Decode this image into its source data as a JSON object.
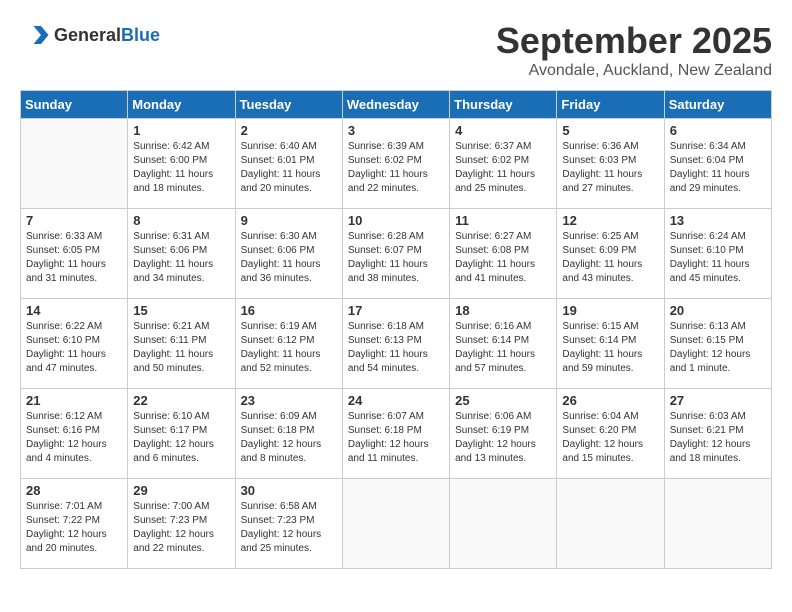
{
  "header": {
    "logo_general": "General",
    "logo_blue": "Blue",
    "month": "September 2025",
    "location": "Avondale, Auckland, New Zealand"
  },
  "weekdays": [
    "Sunday",
    "Monday",
    "Tuesday",
    "Wednesday",
    "Thursday",
    "Friday",
    "Saturday"
  ],
  "weeks": [
    [
      {
        "day": "",
        "sunrise": "",
        "sunset": "",
        "daylight": ""
      },
      {
        "day": "1",
        "sunrise": "Sunrise: 6:42 AM",
        "sunset": "Sunset: 6:00 PM",
        "daylight": "Daylight: 11 hours and 18 minutes."
      },
      {
        "day": "2",
        "sunrise": "Sunrise: 6:40 AM",
        "sunset": "Sunset: 6:01 PM",
        "daylight": "Daylight: 11 hours and 20 minutes."
      },
      {
        "day": "3",
        "sunrise": "Sunrise: 6:39 AM",
        "sunset": "Sunset: 6:02 PM",
        "daylight": "Daylight: 11 hours and 22 minutes."
      },
      {
        "day": "4",
        "sunrise": "Sunrise: 6:37 AM",
        "sunset": "Sunset: 6:02 PM",
        "daylight": "Daylight: 11 hours and 25 minutes."
      },
      {
        "day": "5",
        "sunrise": "Sunrise: 6:36 AM",
        "sunset": "Sunset: 6:03 PM",
        "daylight": "Daylight: 11 hours and 27 minutes."
      },
      {
        "day": "6",
        "sunrise": "Sunrise: 6:34 AM",
        "sunset": "Sunset: 6:04 PM",
        "daylight": "Daylight: 11 hours and 29 minutes."
      }
    ],
    [
      {
        "day": "7",
        "sunrise": "Sunrise: 6:33 AM",
        "sunset": "Sunset: 6:05 PM",
        "daylight": "Daylight: 11 hours and 31 minutes."
      },
      {
        "day": "8",
        "sunrise": "Sunrise: 6:31 AM",
        "sunset": "Sunset: 6:06 PM",
        "daylight": "Daylight: 11 hours and 34 minutes."
      },
      {
        "day": "9",
        "sunrise": "Sunrise: 6:30 AM",
        "sunset": "Sunset: 6:06 PM",
        "daylight": "Daylight: 11 hours and 36 minutes."
      },
      {
        "day": "10",
        "sunrise": "Sunrise: 6:28 AM",
        "sunset": "Sunset: 6:07 PM",
        "daylight": "Daylight: 11 hours and 38 minutes."
      },
      {
        "day": "11",
        "sunrise": "Sunrise: 6:27 AM",
        "sunset": "Sunset: 6:08 PM",
        "daylight": "Daylight: 11 hours and 41 minutes."
      },
      {
        "day": "12",
        "sunrise": "Sunrise: 6:25 AM",
        "sunset": "Sunset: 6:09 PM",
        "daylight": "Daylight: 11 hours and 43 minutes."
      },
      {
        "day": "13",
        "sunrise": "Sunrise: 6:24 AM",
        "sunset": "Sunset: 6:10 PM",
        "daylight": "Daylight: 11 hours and 45 minutes."
      }
    ],
    [
      {
        "day": "14",
        "sunrise": "Sunrise: 6:22 AM",
        "sunset": "Sunset: 6:10 PM",
        "daylight": "Daylight: 11 hours and 47 minutes."
      },
      {
        "day": "15",
        "sunrise": "Sunrise: 6:21 AM",
        "sunset": "Sunset: 6:11 PM",
        "daylight": "Daylight: 11 hours and 50 minutes."
      },
      {
        "day": "16",
        "sunrise": "Sunrise: 6:19 AM",
        "sunset": "Sunset: 6:12 PM",
        "daylight": "Daylight: 11 hours and 52 minutes."
      },
      {
        "day": "17",
        "sunrise": "Sunrise: 6:18 AM",
        "sunset": "Sunset: 6:13 PM",
        "daylight": "Daylight: 11 hours and 54 minutes."
      },
      {
        "day": "18",
        "sunrise": "Sunrise: 6:16 AM",
        "sunset": "Sunset: 6:14 PM",
        "daylight": "Daylight: 11 hours and 57 minutes."
      },
      {
        "day": "19",
        "sunrise": "Sunrise: 6:15 AM",
        "sunset": "Sunset: 6:14 PM",
        "daylight": "Daylight: 11 hours and 59 minutes."
      },
      {
        "day": "20",
        "sunrise": "Sunrise: 6:13 AM",
        "sunset": "Sunset: 6:15 PM",
        "daylight": "Daylight: 12 hours and 1 minute."
      }
    ],
    [
      {
        "day": "21",
        "sunrise": "Sunrise: 6:12 AM",
        "sunset": "Sunset: 6:16 PM",
        "daylight": "Daylight: 12 hours and 4 minutes."
      },
      {
        "day": "22",
        "sunrise": "Sunrise: 6:10 AM",
        "sunset": "Sunset: 6:17 PM",
        "daylight": "Daylight: 12 hours and 6 minutes."
      },
      {
        "day": "23",
        "sunrise": "Sunrise: 6:09 AM",
        "sunset": "Sunset: 6:18 PM",
        "daylight": "Daylight: 12 hours and 8 minutes."
      },
      {
        "day": "24",
        "sunrise": "Sunrise: 6:07 AM",
        "sunset": "Sunset: 6:18 PM",
        "daylight": "Daylight: 12 hours and 11 minutes."
      },
      {
        "day": "25",
        "sunrise": "Sunrise: 6:06 AM",
        "sunset": "Sunset: 6:19 PM",
        "daylight": "Daylight: 12 hours and 13 minutes."
      },
      {
        "day": "26",
        "sunrise": "Sunrise: 6:04 AM",
        "sunset": "Sunset: 6:20 PM",
        "daylight": "Daylight: 12 hours and 15 minutes."
      },
      {
        "day": "27",
        "sunrise": "Sunrise: 6:03 AM",
        "sunset": "Sunset: 6:21 PM",
        "daylight": "Daylight: 12 hours and 18 minutes."
      }
    ],
    [
      {
        "day": "28",
        "sunrise": "Sunrise: 7:01 AM",
        "sunset": "Sunset: 7:22 PM",
        "daylight": "Daylight: 12 hours and 20 minutes."
      },
      {
        "day": "29",
        "sunrise": "Sunrise: 7:00 AM",
        "sunset": "Sunset: 7:23 PM",
        "daylight": "Daylight: 12 hours and 22 minutes."
      },
      {
        "day": "30",
        "sunrise": "Sunrise: 6:58 AM",
        "sunset": "Sunset: 7:23 PM",
        "daylight": "Daylight: 12 hours and 25 minutes."
      },
      {
        "day": "",
        "sunrise": "",
        "sunset": "",
        "daylight": ""
      },
      {
        "day": "",
        "sunrise": "",
        "sunset": "",
        "daylight": ""
      },
      {
        "day": "",
        "sunrise": "",
        "sunset": "",
        "daylight": ""
      },
      {
        "day": "",
        "sunrise": "",
        "sunset": "",
        "daylight": ""
      }
    ]
  ]
}
